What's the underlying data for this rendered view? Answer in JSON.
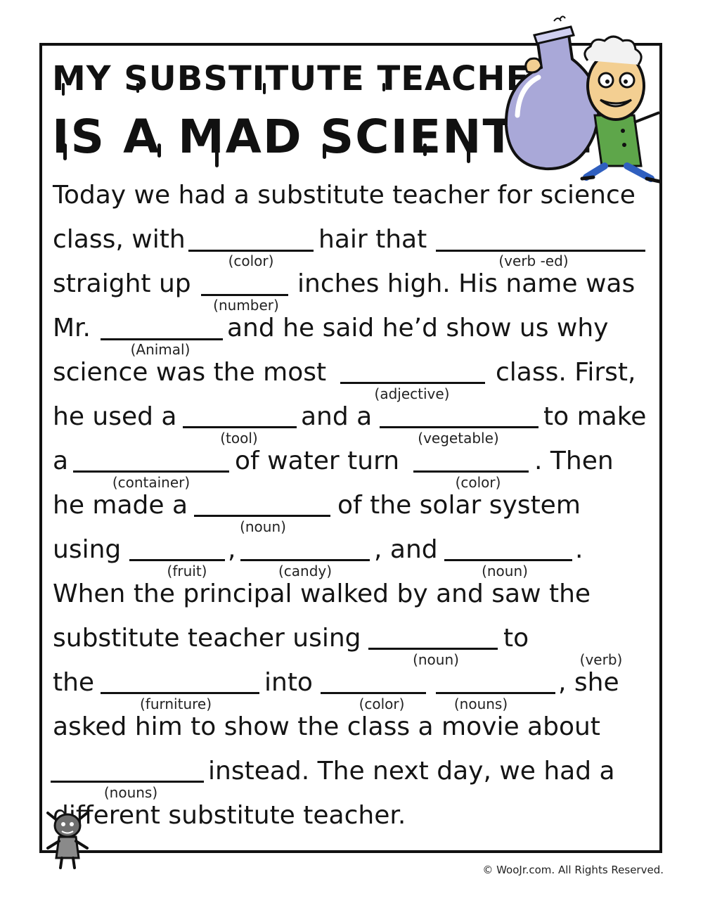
{
  "title": {
    "line1": "My Substitute Teacher",
    "line2": "Is a Mad Scientist"
  },
  "story": [
    {
      "segments": [
        "Today we had a substitute teacher for science"
      ],
      "hints": []
    },
    {
      "segments": [
        "class, with",
        "hair that"
      ],
      "hints": [
        "(color)",
        "(verb -ed)"
      ]
    },
    {
      "segments": [
        "straight up",
        "inches high. His name was"
      ],
      "hints": [
        "(number)"
      ]
    },
    {
      "segments": [
        "Mr.",
        "and he said he’d show us why"
      ],
      "hints": [
        "(Animal)"
      ]
    },
    {
      "segments": [
        "science was the most",
        "class. First,"
      ],
      "hints": [
        "(adjective)"
      ]
    },
    {
      "segments": [
        "he used a",
        "and a",
        "to make"
      ],
      "hints": [
        "(tool)",
        "(vegetable)"
      ]
    },
    {
      "segments": [
        "a",
        "of water turn",
        ". Then"
      ],
      "hints": [
        "(container)",
        "(color)"
      ]
    },
    {
      "segments": [
        "he made a",
        "of the solar system"
      ],
      "hints": [
        "(noun)"
      ]
    },
    {
      "segments": [
        "using",
        ",",
        ", and",
        "."
      ],
      "hints": [
        "(fruit)",
        "(candy)",
        "(noun)"
      ]
    },
    {
      "segments": [
        "When the principal walked by and saw the"
      ],
      "hints": []
    },
    {
      "segments": [
        "substitute teacher using",
        "to"
      ],
      "hints": [
        "(noun)",
        "(verb)"
      ]
    },
    {
      "segments": [
        "the",
        "into",
        ", she"
      ],
      "hints": [
        "(furniture)",
        "(color)",
        "(nouns)"
      ]
    },
    {
      "segments": [
        "asked him to show the class a movie about"
      ],
      "hints": []
    },
    {
      "segments": [
        "instead. The next day, we had a"
      ],
      "hints": [
        "(nouns)"
      ]
    },
    {
      "segments": [
        "different substitute teacher."
      ],
      "hints": []
    }
  ],
  "footer": {
    "copyright": "© WooJr.com. All Rights Reserved."
  },
  "colors": {
    "ink": "#111111",
    "flask": "#a9a8d8",
    "coat": "#5ea64a",
    "pants": "#2f5fbf",
    "skin": "#f3cf92"
  },
  "icons": [
    "mad-scientist-icon",
    "little-monster-icon"
  ]
}
